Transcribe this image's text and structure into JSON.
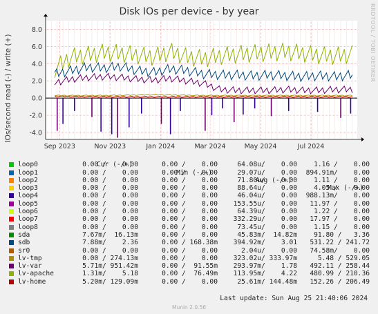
{
  "title": "Disk IOs per device - by year",
  "side_text": "RRDTOOL / TOBI OETIKER",
  "last_update": "Last update:  Sun Aug 25 21:40:06 2024",
  "footer": "Munin 2.0.56",
  "legend_headers": {
    "cur": "Cur (-/+)",
    "min": "Min (-/+)",
    "avg": "Avg (-/+)",
    "max": "Max (-/+)"
  },
  "legend": [
    {
      "name": "loop0",
      "color": "#00cc00",
      "cur": "0.00 /    0.00",
      "min": "0.00 /    0.00",
      "avg": "64.08u/    0.00",
      "max": "1.16 /    0.00"
    },
    {
      "name": "loop1",
      "color": "#0066b3",
      "cur": "0.00 /    0.00",
      "min": "0.00 /    0.00",
      "avg": "29.07u/    0.00",
      "max": "894.91m/    0.00"
    },
    {
      "name": "loop2",
      "color": "#ff8000",
      "cur": "0.00 /    0.00",
      "min": "0.00 /    0.00",
      "avg": "71.80u/    0.00",
      "max": "1.11 /    0.00"
    },
    {
      "name": "loop3",
      "color": "#ffcc00",
      "cur": "0.00 /    0.00",
      "min": "0.00 /    0.00",
      "avg": "88.64u/    0.00",
      "max": "4.05 /    0.00"
    },
    {
      "name": "loop4",
      "color": "#330099",
      "cur": "0.00 /    0.00",
      "min": "0.00 /    0.00",
      "avg": "46.04u/    0.00",
      "max": "988.13m/    0.00"
    },
    {
      "name": "loop5",
      "color": "#990099",
      "cur": "0.00 /    0.00",
      "min": "0.00 /    0.00",
      "avg": "153.55u/    0.00",
      "max": "11.97 /    0.00"
    },
    {
      "name": "loop6",
      "color": "#ccff00",
      "cur": "0.00 /    0.00",
      "min": "0.00 /    0.00",
      "avg": "64.39u/    0.00",
      "max": "1.22 /    0.00"
    },
    {
      "name": "loop7",
      "color": "#ff0000",
      "cur": "0.00 /    0.00",
      "min": "0.00 /    0.00",
      "avg": "332.29u/    0.00",
      "max": "17.97 /    0.00"
    },
    {
      "name": "loop8",
      "color": "#808080",
      "cur": "0.00 /    0.00",
      "min": "0.00 /    0.00",
      "avg": "73.45u/    0.00",
      "max": "1.15 /    0.00"
    },
    {
      "name": "sda",
      "color": "#008f00",
      "cur": "7.67m/  16.13m",
      "min": "0.00 /    0.00",
      "avg": "45.83m/  14.82m",
      "max": "91.80 /   3.36"
    },
    {
      "name": "sdb",
      "color": "#00487d",
      "cur": "7.88m/    2.36",
      "min": "0.00 / 168.38m",
      "avg": "394.92m/    3.01",
      "max": "531.22 / 241.72"
    },
    {
      "name": "sr0",
      "color": "#b35a00",
      "cur": "0.00 /    0.00",
      "min": "0.00 /    0.00",
      "avg": "2.04u/    0.00",
      "max": "74.58m/    0.00"
    },
    {
      "name": "lv-tmp",
      "color": "#b38f00",
      "cur": "0.00 / 274.13m",
      "min": "0.00 /    0.00",
      "avg": "323.02u/ 333.97m",
      "max": "5.48 / 529.05"
    },
    {
      "name": "lv-var",
      "color": "#6b006b",
      "cur": "5.71m/ 951.42m",
      "min": "0.00 /  91.55m",
      "avg": "293.97m/    1.78",
      "max": "492.11 / 258.44"
    },
    {
      "name": "lv-apache",
      "color": "#8fb300",
      "cur": "1.31m/    5.18",
      "min": "0.00 /  76.49m",
      "avg": "113.95m/    4.22",
      "max": "480.99 / 210.36"
    },
    {
      "name": "lv-home",
      "color": "#b30000",
      "cur": "5.20m/ 129.09m",
      "min": "0.00 /    0.00",
      "avg": "25.61m/ 144.48m",
      "max": "152.26 / 206.49"
    }
  ],
  "chart_data": {
    "type": "line",
    "title": "Disk IOs per device - by year",
    "ylabel": "IOs/second read (-) / write (+)",
    "xlabel": "",
    "ylim": [
      -4.8,
      9.0
    ],
    "yticks": [
      "-4.0",
      "-2.0",
      "0.0",
      "2.0",
      "4.0",
      "6.0",
      "8.0"
    ],
    "ytick_values": [
      -4,
      -2,
      0,
      2,
      4,
      6,
      8
    ],
    "xticks": [
      "Sep 2023",
      "Nov 2023",
      "Jan 2024",
      "Mar 2024",
      "May 2024",
      "Jul 2024"
    ],
    "grid": true,
    "series": [
      {
        "name": "lv-apache",
        "color": "#8fb300",
        "x": [
          "2023-08-26",
          "2023-09-15",
          "2023-10-05",
          "2023-10-25",
          "2023-11-14",
          "2023-12-04",
          "2023-12-24",
          "2024-01-13",
          "2024-02-02",
          "2024-02-22",
          "2024-03-13",
          "2024-04-02",
          "2024-04-22",
          "2024-05-12",
          "2024-06-01",
          "2024-06-21",
          "2024-07-11",
          "2024-07-31",
          "2024-08-20"
        ],
        "values": [
          3.4,
          4.8,
          5.0,
          5.3,
          5.2,
          5.0,
          4.8,
          5.4,
          4.8,
          4.6,
          4.9,
          5.1,
          5.2,
          5.3,
          5.4,
          5.2,
          5.0,
          4.9,
          5.1
        ]
      },
      {
        "name": "sdb",
        "color": "#00487d",
        "x": [
          "2023-08-26",
          "2023-09-15",
          "2023-10-05",
          "2023-10-25",
          "2023-11-14",
          "2023-12-04",
          "2023-12-24",
          "2024-01-13",
          "2024-02-02",
          "2024-02-22",
          "2024-03-13",
          "2024-04-02",
          "2024-04-22",
          "2024-05-12",
          "2024-06-01",
          "2024-06-21",
          "2024-07-11",
          "2024-07-31",
          "2024-08-20"
        ],
        "values": [
          2.8,
          3.2,
          3.6,
          3.5,
          3.7,
          3.2,
          3.0,
          3.4,
          3.2,
          2.8,
          2.7,
          2.7,
          2.6,
          2.7,
          2.6,
          2.5,
          2.6,
          2.5,
          2.7
        ]
      },
      {
        "name": "lv-var",
        "color": "#6b006b",
        "x": [
          "2023-08-26",
          "2023-09-15",
          "2023-10-05",
          "2023-10-25",
          "2023-11-14",
          "2023-12-04",
          "2023-12-24",
          "2024-01-13",
          "2024-02-02",
          "2024-02-22",
          "2024-03-13",
          "2024-04-02",
          "2024-04-22",
          "2024-05-12",
          "2024-06-01",
          "2024-06-21",
          "2024-07-11",
          "2024-07-31",
          "2024-08-20"
        ],
        "values": [
          1.8,
          2.2,
          2.4,
          2.5,
          2.4,
          2.2,
          2.1,
          2.3,
          2.0,
          1.7,
          1.0,
          0.9,
          0.9,
          0.9,
          1.0,
          0.9,
          0.9,
          1.0,
          1.0
        ]
      },
      {
        "name": "lv-home",
        "color": "#b30000",
        "x": [
          "2023-08-26",
          "2023-10-25",
          "2023-12-24",
          "2024-02-22",
          "2024-04-22",
          "2024-06-21",
          "2024-08-20"
        ],
        "values": [
          0.2,
          0.15,
          0.15,
          0.15,
          0.15,
          0.15,
          0.15
        ]
      },
      {
        "name": "lv-tmp",
        "color": "#b38f00",
        "x": [
          "2023-08-26",
          "2023-10-25",
          "2023-12-24",
          "2024-02-22",
          "2024-04-22",
          "2024-06-21",
          "2024-08-20"
        ],
        "values": [
          0.3,
          0.3,
          0.4,
          0.3,
          0.3,
          0.3,
          0.3
        ]
      }
    ],
    "read_spikes": [
      {
        "x": "2023-08-29",
        "value": -3.8
      },
      {
        "x": "2023-09-05",
        "value": -3.0
      },
      {
        "x": "2023-09-19",
        "value": -1.5
      },
      {
        "x": "2023-10-10",
        "value": -2.2
      },
      {
        "x": "2023-10-21",
        "value": -3.9
      },
      {
        "x": "2023-11-03",
        "value": -4.2
      },
      {
        "x": "2023-11-10",
        "value": -4.6
      },
      {
        "x": "2023-11-24",
        "value": -3.4
      },
      {
        "x": "2023-12-09",
        "value": -1.8
      },
      {
        "x": "2024-01-02",
        "value": -3.0
      },
      {
        "x": "2024-01-13",
        "value": -4.2
      },
      {
        "x": "2024-01-25",
        "value": -1.5
      },
      {
        "x": "2024-02-24",
        "value": -3.8
      },
      {
        "x": "2024-03-03",
        "value": -2.0
      },
      {
        "x": "2024-03-16",
        "value": -1.2
      },
      {
        "x": "2024-03-30",
        "value": -2.8
      },
      {
        "x": "2024-04-10",
        "value": -1.9
      },
      {
        "x": "2024-04-24",
        "value": -1.2
      },
      {
        "x": "2024-05-14",
        "value": -2.1
      },
      {
        "x": "2024-06-04",
        "value": -1.5
      },
      {
        "x": "2024-07-09",
        "value": -1.6
      },
      {
        "x": "2024-08-06",
        "value": -2.3
      },
      {
        "x": "2024-08-18",
        "value": -1.8
      }
    ]
  }
}
